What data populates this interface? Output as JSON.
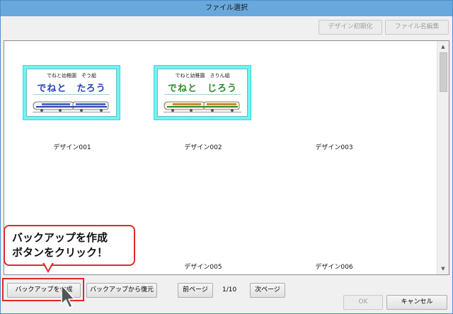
{
  "window": {
    "title": "ファイル選択"
  },
  "toolbar": {
    "design_reset": "デザイン初期化",
    "file_rename": "ファイル名編集"
  },
  "designs": [
    {
      "school": "でねと幼稚園　ぞう組",
      "name": "でねと　たろう",
      "label": "デザイン001"
    },
    {
      "school": "でねと幼稚園　きりん組",
      "name": "でねと　じろう",
      "label": "デザイン002"
    },
    {
      "label": "デザイン003"
    },
    {
      "label": "デザイン005"
    },
    {
      "label": "デザイン006"
    }
  ],
  "callout": {
    "text": "バックアップを作成\nボタンをクリック！"
  },
  "footer": {
    "backup_create": "バックアップを作成",
    "backup_restore": "バックアップから復元",
    "prev_page": "前ページ",
    "page_indicator": "1/10",
    "next_page": "次ページ",
    "ok": "OK",
    "cancel": "キャンセル"
  },
  "colors": {
    "titlebar": "#69a8dc",
    "card_border": "#6ff3f3",
    "callout_border": "#e0282b",
    "name_blue": "#2a3fb0",
    "name_green": "#2f8a2a"
  }
}
